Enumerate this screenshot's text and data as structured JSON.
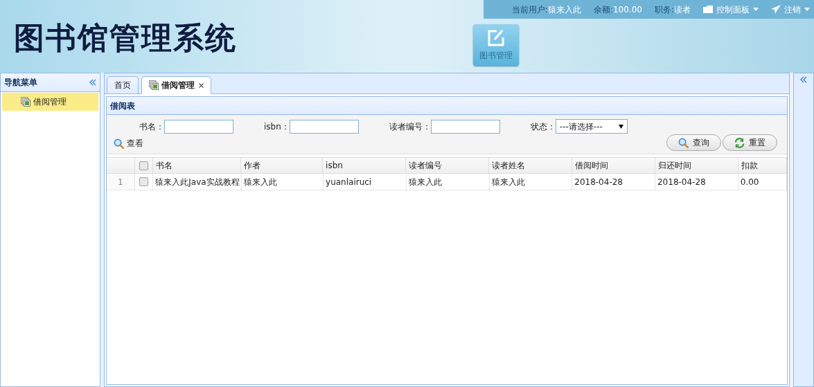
{
  "header": {
    "logo_title": "图书馆管理系统",
    "user_info": [
      {
        "label": "当前用户:",
        "value": "猿来入此"
      },
      {
        "label": "余额:",
        "value": "100.00"
      },
      {
        "label": "职务:",
        "value": "读者"
      }
    ],
    "menus": [
      {
        "label": "控制面板",
        "kind": "panel"
      },
      {
        "label": "注销",
        "kind": "logout"
      }
    ],
    "toolbar": [
      {
        "label": "图书管理"
      }
    ]
  },
  "sidebar": {
    "title": "导航菜单",
    "items": [
      {
        "label": "借阅管理",
        "selected": true
      }
    ]
  },
  "tabs": [
    {
      "label": "首页",
      "selected": false,
      "closable": false
    },
    {
      "label": "借阅管理",
      "selected": true,
      "closable": true
    }
  ],
  "panel": {
    "title": "借阅表",
    "filters": [
      {
        "label": "书名：",
        "kind": "text"
      },
      {
        "label": "isbn：",
        "kind": "text"
      },
      {
        "label": "读者编号：",
        "kind": "text"
      },
      {
        "label": "状态：",
        "kind": "select",
        "value": "---请选择---"
      }
    ],
    "view_link": "查看",
    "buttons": [
      {
        "label": "查询",
        "kind": "search"
      },
      {
        "label": "重置",
        "kind": "reset"
      }
    ]
  },
  "table": {
    "all_checked": false,
    "columns": [
      "书名",
      "作者",
      "isbn",
      "读者编号",
      "读者姓名",
      "借阅时间",
      "归还时间",
      "扣款"
    ],
    "rows": [
      {
        "row_number": "1",
        "checked": false,
        "cells": [
          "猿来入此Java实战教程",
          "猿来入此",
          "yuanlairuci",
          "猿来入此",
          "猿来入此",
          "2018-04-28",
          "2018-04-28",
          "0.00"
        ]
      }
    ]
  }
}
